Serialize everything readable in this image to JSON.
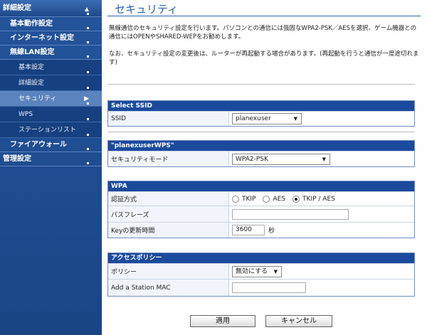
{
  "sidebar": {
    "top": "詳細設定",
    "items": [
      {
        "label": "基本動作設定"
      },
      {
        "label": "インターネット設定"
      },
      {
        "label": "無線LAN設定"
      },
      {
        "label": "基本設定"
      },
      {
        "label": "詳細設定"
      },
      {
        "label": "セキュリティ"
      },
      {
        "label": "WPS"
      },
      {
        "label": "ステーションリスト"
      },
      {
        "label": "ファイアウォール"
      },
      {
        "label": "管理設定"
      }
    ]
  },
  "main": {
    "title": "セキュリティ",
    "desc1": "無線通信のセキュリティ設定を行います。パソコンとの通信には強固なWPA2-PSK／AESを選択、ゲーム機器との通信にはOPENやSHARED-WEPをお勧めします。",
    "desc2": "なお、セキュリティ設定の変更後は、ルーターが再起動する場合があります。(再起動を行うと通信が一度途切れます)"
  },
  "select_ssid": {
    "header": "Select SSID",
    "label": "SSID",
    "value": "planexuser"
  },
  "wps_section": {
    "header": "\"planexuserWPS\"",
    "label": "セキュリティモード",
    "value": "WPA2-PSK"
  },
  "wpa": {
    "header": "WPA",
    "auth_label": "認証方式",
    "opt_tkip": "TKIP",
    "opt_aes": "AES",
    "opt_tkip_aes": "TKIP / AES",
    "passphrase_label": "パスフレーズ",
    "passphrase_value": "",
    "key_update_label": "Keyの更新時間",
    "key_update_value": "3600",
    "key_update_unit": "秒"
  },
  "access_policy": {
    "header": "アクセスポリシー",
    "policy_label": "ポリシー",
    "policy_value": "無効にする",
    "mac_label": "Add a Station MAC",
    "mac_value": ""
  },
  "buttons": {
    "apply": "適用",
    "cancel": "キャンセル"
  }
}
